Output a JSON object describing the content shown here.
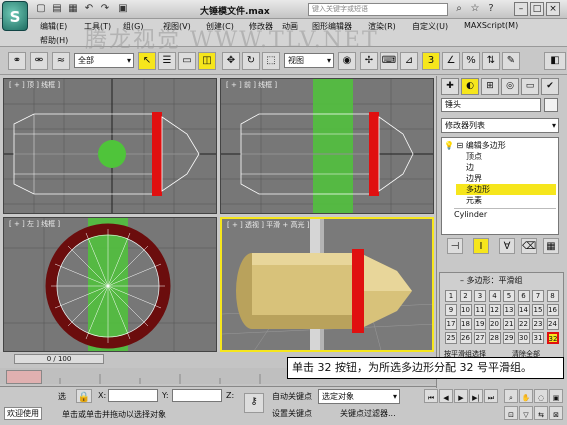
{
  "title_bar": {
    "doc_title": "大锤模文件.max",
    "search_placeholder": "键入关键字或短语"
  },
  "menu": {
    "row1": [
      "编辑(E)",
      "工具(T)",
      "组(G)",
      "视图(V)",
      "创建(C)",
      "修改器",
      "动画",
      "图形编辑器",
      "渲染(R)",
      "自定义(U)",
      "MAXScript(M)"
    ],
    "row2": [
      "帮助(H)"
    ]
  },
  "watermark": "腾龙视觉 WWW.TLV.NET",
  "toolbar": {
    "filter": "全部",
    "coord": "视图"
  },
  "viewports": {
    "top": "[ + ] 顶 ] 线框 ]",
    "front": "[ + ] 前 ] 线框 ]",
    "left": "[ + ] 左 ] 线框 ]",
    "persp": "[ + ] 透视 ] 平滑 + 高光 ]"
  },
  "command_panel": {
    "object_name": "锤头",
    "modifier_list": "修改器列表",
    "stack": {
      "mod": "编辑多边形",
      "items": [
        "顶点",
        "边",
        "边界",
        "多边形",
        "元素"
      ],
      "base": "Cylinder"
    },
    "smoothing": {
      "title": "多边形：平滑组",
      "buttons": [
        "1",
        "2",
        "3",
        "4",
        "5",
        "6",
        "7",
        "8",
        "9",
        "10",
        "11",
        "12",
        "13",
        "14",
        "15",
        "16",
        "17",
        "18",
        "19",
        "20",
        "21",
        "22",
        "23",
        "24",
        "25",
        "26",
        "27",
        "28",
        "29",
        "30",
        "31",
        "32"
      ],
      "by_sg": "按平滑组选择",
      "clear_all": "清除全部"
    }
  },
  "timeline": {
    "frame": "0 / 100"
  },
  "status": {
    "welcome": "欢迎使用",
    "selected": "选",
    "x_label": "X:",
    "y_label": "Y:",
    "z_label": "Z:",
    "prompt": "单击或单击并拖动以选择对象",
    "auto_key": "自动关键点",
    "set_key": "设置关键点",
    "selected_obj": "选定对象",
    "key_filter": "关键点过滤器..."
  },
  "callout": "单击 32 按钮，为所选多边形分配 32 号平滑组。",
  "colors": {
    "accent_red": "#e01010",
    "green": "#4fc43a",
    "yellow_sel": "#f6e61c",
    "body": "#d8c27a"
  }
}
